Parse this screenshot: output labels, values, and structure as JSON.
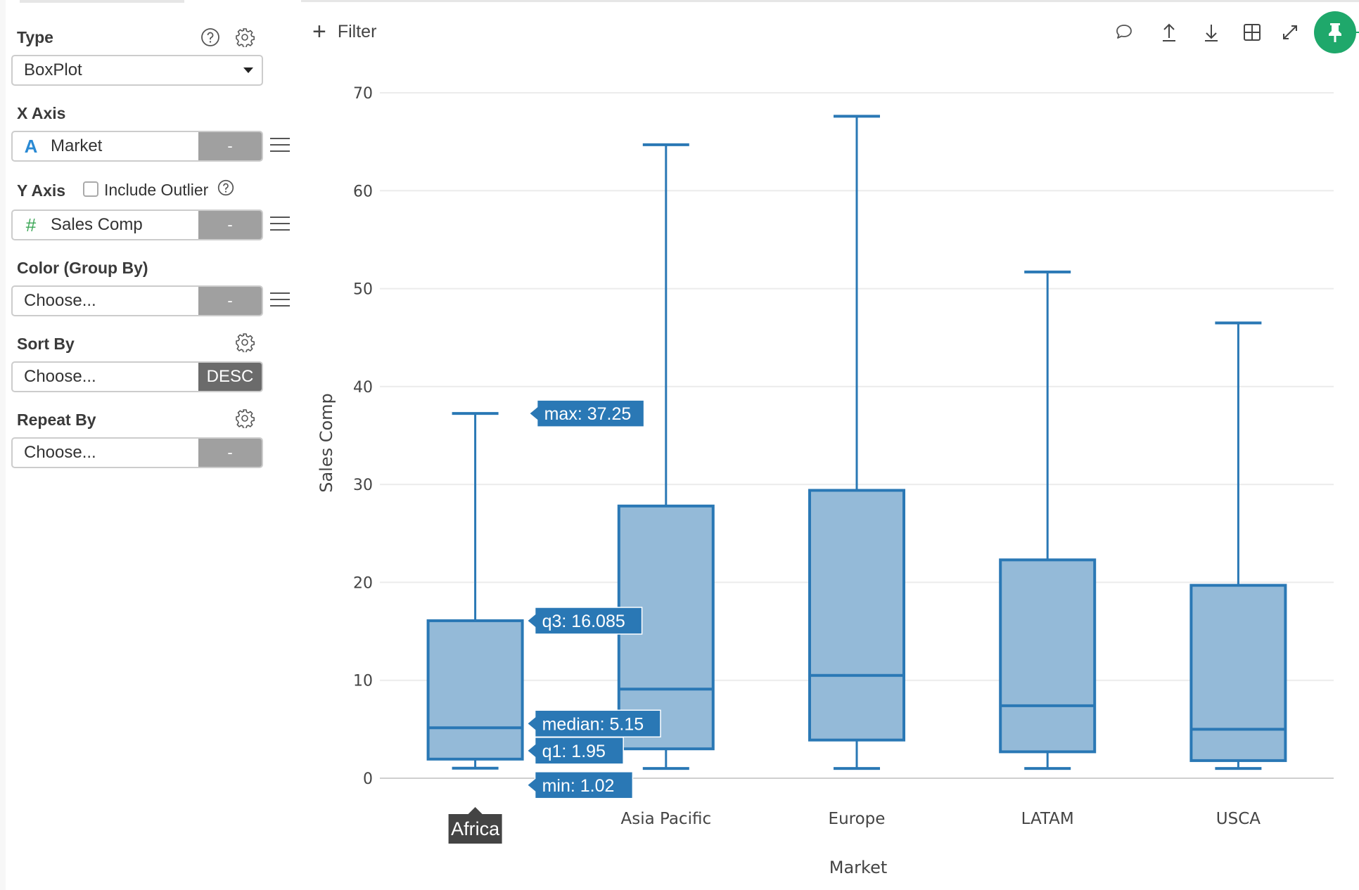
{
  "sidebar": {
    "type": {
      "label": "Type",
      "value": "BoxPlot"
    },
    "x_axis": {
      "label": "X Axis",
      "type_icon": "A",
      "value": "Market",
      "action": "-"
    },
    "y_axis": {
      "label": "Y Axis",
      "include_outlier_label": "Include Outlier",
      "include_outlier_checked": false,
      "type_icon": "#",
      "value": "Sales Comp",
      "action": "-"
    },
    "color": {
      "label": "Color (Group By)",
      "value": "Choose...",
      "action": "-"
    },
    "sort": {
      "label": "Sort By",
      "value": "Choose...",
      "action": "DESC"
    },
    "repeat": {
      "label": "Repeat By",
      "value": "Choose...",
      "action": "-"
    }
  },
  "toolbar": {
    "filter_label": "Filter",
    "icons": [
      "comment-icon",
      "upload-icon",
      "download-icon",
      "grid-icon",
      "expand-icon",
      "pin-icon"
    ]
  },
  "colors": {
    "box_stroke": "#2a78b5",
    "box_fill": "#94bad8",
    "tooltip_bg": "#2a78b5",
    "hover_label_bg": "#444444",
    "pin_green": "#1fa86b",
    "x_icon_blue": "#2a8ad4",
    "y_icon_green": "#3aa655"
  },
  "chart_data": {
    "type": "box",
    "title": "",
    "xlabel": "Market",
    "ylabel": "Sales Comp",
    "ylim": [
      0,
      70
    ],
    "yticks": [
      0,
      10,
      20,
      30,
      40,
      50,
      60,
      70
    ],
    "grid": true,
    "categories": [
      "Africa",
      "Asia Pacific",
      "Europe",
      "LATAM",
      "USCA"
    ],
    "boxes": [
      {
        "name": "Africa",
        "min": 1.02,
        "q1": 1.95,
        "median": 5.15,
        "q3": 16.085,
        "max": 37.25
      },
      {
        "name": "Asia Pacific",
        "min": 1.0,
        "q1": 3.0,
        "median": 9.1,
        "q3": 27.8,
        "max": 64.7
      },
      {
        "name": "Europe",
        "min": 1.0,
        "q1": 3.9,
        "median": 10.5,
        "q3": 29.4,
        "max": 67.6
      },
      {
        "name": "LATAM",
        "min": 1.0,
        "q1": 2.7,
        "median": 7.4,
        "q3": 22.3,
        "max": 51.7
      },
      {
        "name": "USCA",
        "min": 1.0,
        "q1": 1.8,
        "median": 5.0,
        "q3": 19.7,
        "max": 46.5
      }
    ],
    "hover": {
      "category": "Africa",
      "labels": [
        {
          "key": "max",
          "text": "max: 37.25"
        },
        {
          "key": "q3",
          "text": "q3: 16.085"
        },
        {
          "key": "median",
          "text": "median: 5.15"
        },
        {
          "key": "q1",
          "text": "q1: 1.95"
        },
        {
          "key": "min",
          "text": "min: 1.02"
        }
      ]
    }
  }
}
